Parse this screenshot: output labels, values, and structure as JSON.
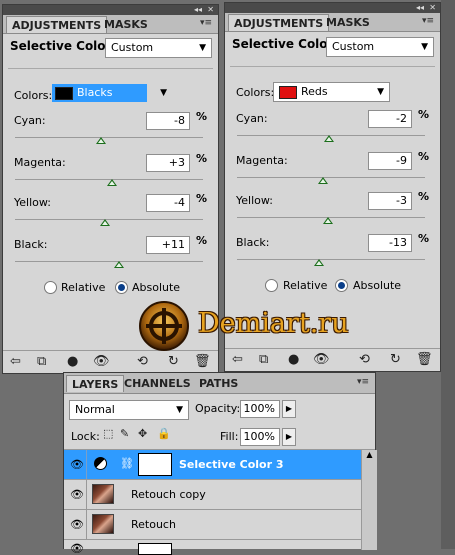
{
  "left_panel": {
    "tabs": [
      "ADJUSTMENTS",
      "MASKS"
    ],
    "title": "Selective Color",
    "preset": "Custom",
    "colors_label": "Colors:",
    "colors_value": "Blacks",
    "swatch_color": "#000000",
    "sliders": [
      {
        "label": "Cyan:",
        "value": "-8",
        "pct": "%",
        "level": -8
      },
      {
        "label": "Magenta:",
        "value": "+3",
        "pct": "%",
        "level": 3
      },
      {
        "label": "Yellow:",
        "value": "-4",
        "pct": "%",
        "level": -4
      },
      {
        "label": "Black:",
        "value": "+11",
        "pct": "%",
        "level": 11
      }
    ],
    "relative_label": "Relative",
    "absolute_label": "Absolute",
    "method": "Absolute"
  },
  "right_panel": {
    "tabs": [
      "ADJUSTMENTS",
      "MASKS"
    ],
    "title": "Selective Color",
    "preset": "Custom",
    "colors_label": "Colors:",
    "colors_value": "Reds",
    "swatch_color": "#e01010",
    "sliders": [
      {
        "label": "Cyan:",
        "value": "-2",
        "pct": "%",
        "level": -2
      },
      {
        "label": "Magenta:",
        "value": "-9",
        "pct": "%",
        "level": -9
      },
      {
        "label": "Yellow:",
        "value": "-3",
        "pct": "%",
        "level": -3
      },
      {
        "label": "Black:",
        "value": "-13",
        "pct": "%",
        "level": -13
      }
    ],
    "relative_label": "Relative",
    "absolute_label": "Absolute",
    "method": "Absolute"
  },
  "watermark": {
    "text": "Demiart.ru"
  },
  "layers_panel": {
    "tabs": [
      "LAYERS",
      "CHANNELS",
      "PATHS"
    ],
    "blend_mode": "Normal",
    "opacity_label": "Opacity:",
    "opacity_value": "100%",
    "lock_label": "Lock:",
    "fill_label": "Fill:",
    "fill_value": "100%",
    "layers": [
      {
        "name": "Selective Color 3",
        "selected": true
      },
      {
        "name": "Retouch copy",
        "selected": false
      },
      {
        "name": "Retouch",
        "selected": false
      }
    ]
  },
  "colors": {
    "selection": "#2f9bff",
    "slider_thumb": "#1c6e1c",
    "panel_bg": "#d6d6d6"
  }
}
